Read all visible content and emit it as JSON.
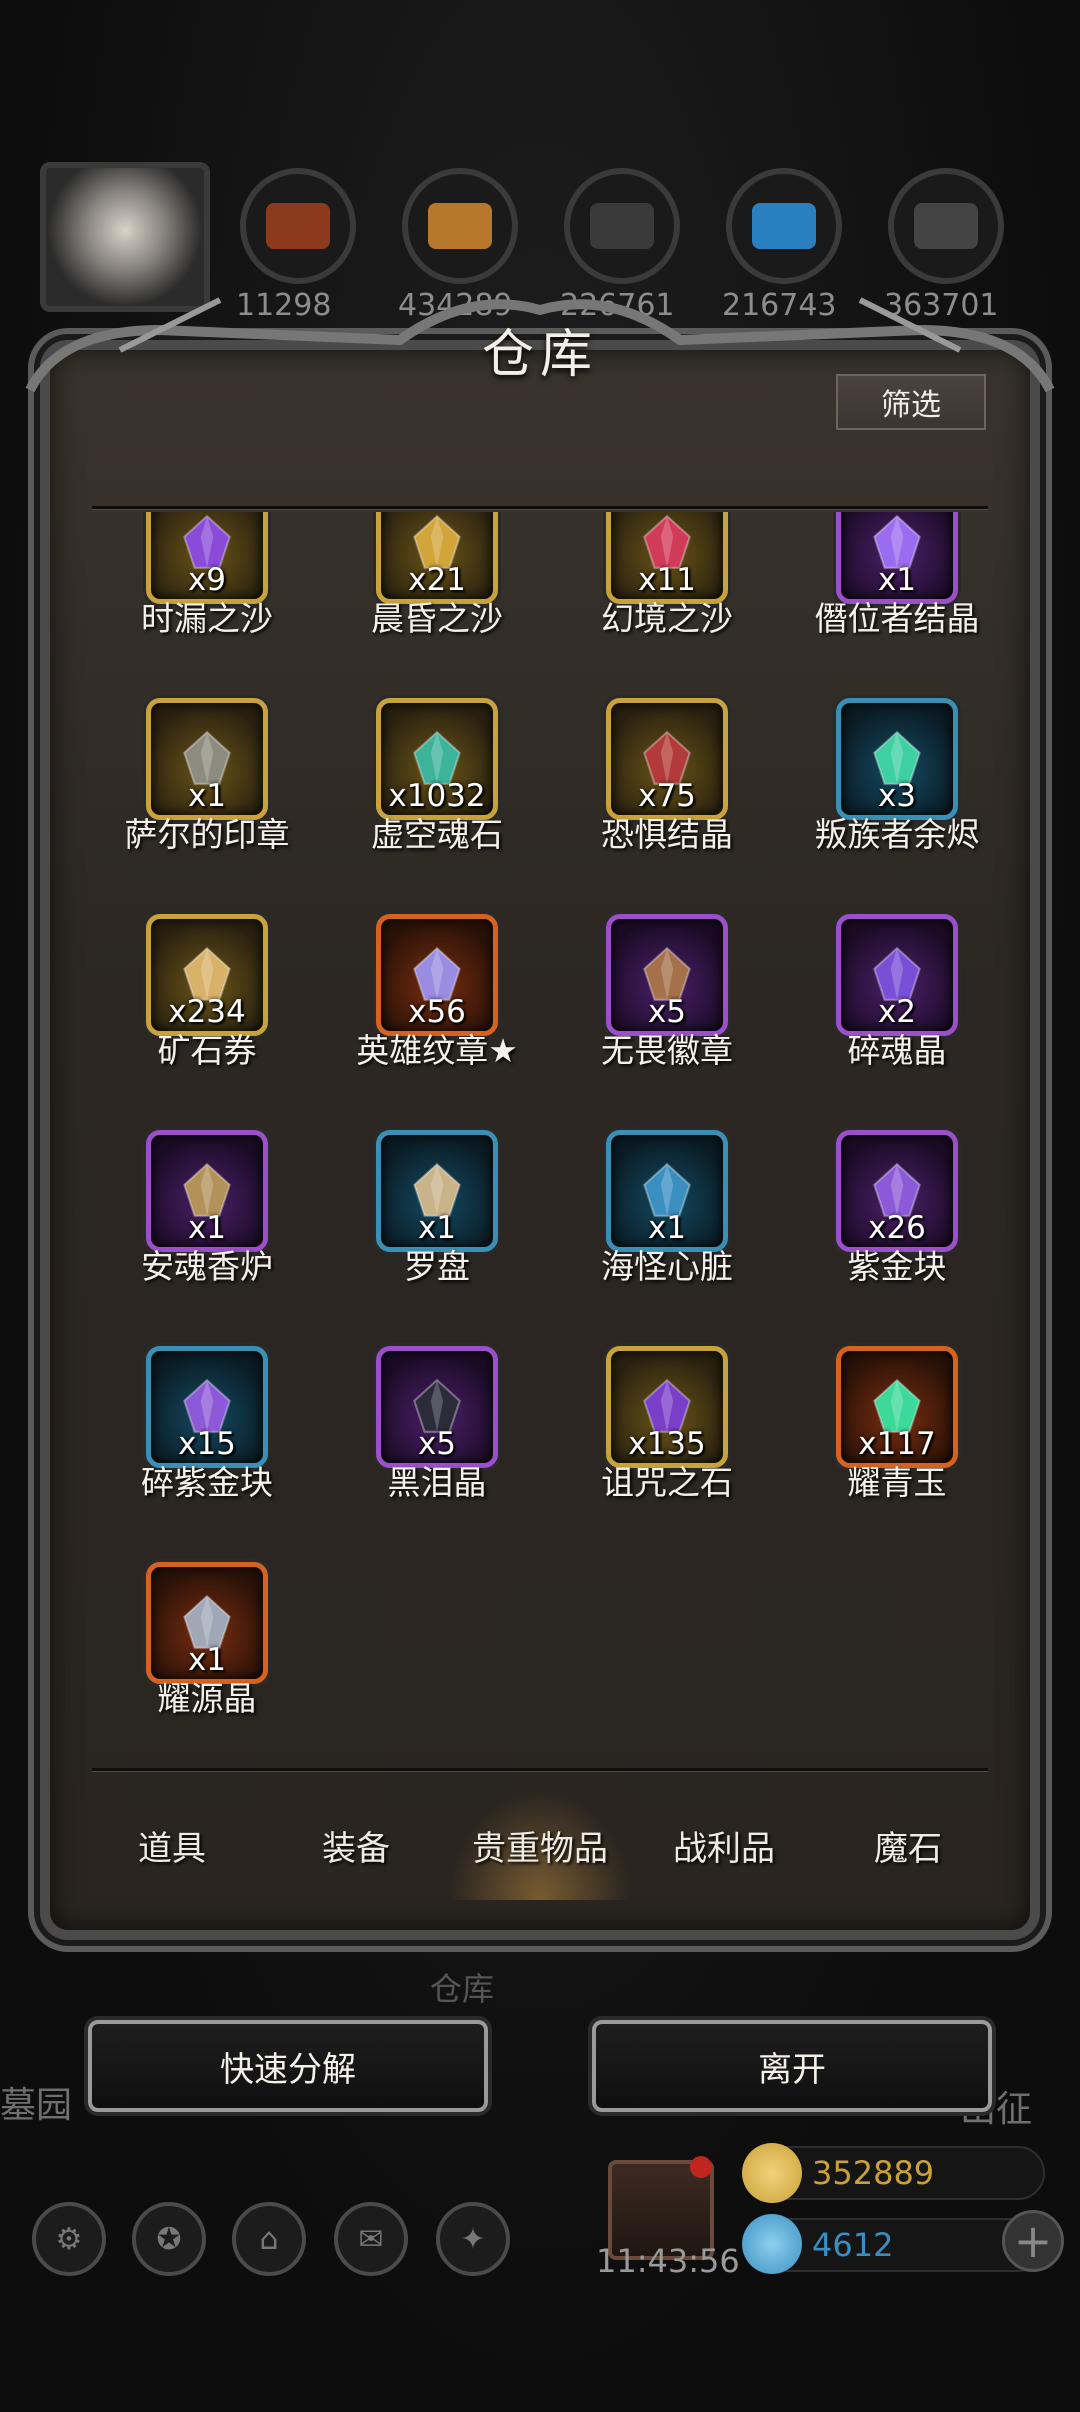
{
  "panel": {
    "title": "仓库",
    "filter_label": "筛选"
  },
  "top_resources": {
    "values": [
      "11298",
      "434289",
      "226761",
      "216743",
      "363701"
    ],
    "colors": [
      "#8b3a1d",
      "#b7772c",
      "#3a3a3a",
      "#2a7fc0",
      "#444444"
    ]
  },
  "items": [
    {
      "name": "时漏之沙",
      "count": "x9",
      "rarity": "gold",
      "color": "#8a4bd8"
    },
    {
      "name": "晨昏之沙",
      "count": "x21",
      "rarity": "gold",
      "color": "#d2a53a"
    },
    {
      "name": "幻境之沙",
      "count": "x11",
      "rarity": "gold",
      "color": "#d23a5a"
    },
    {
      "name": "僭位者结晶",
      "count": "x1",
      "rarity": "purple",
      "color": "#9b6cf0"
    },
    {
      "name": "萨尔的印章",
      "count": "x1",
      "rarity": "gold",
      "color": "#8c8c80"
    },
    {
      "name": "虚空魂石",
      "count": "x1032",
      "rarity": "gold",
      "color": "#3db39a"
    },
    {
      "name": "恐惧结晶",
      "count": "x75",
      "rarity": "gold",
      "color": "#b33a3a"
    },
    {
      "name": "叛族者余烬",
      "count": "x3",
      "rarity": "blue",
      "color": "#3ed0a0"
    },
    {
      "name": "矿石券",
      "count": "x234",
      "rarity": "gold",
      "color": "#d9b26a"
    },
    {
      "name": "英雄纹章★",
      "count": "x56",
      "rarity": "orange",
      "color": "#9a8ce0"
    },
    {
      "name": "无畏徽章",
      "count": "x5",
      "rarity": "purple",
      "color": "#a6704a"
    },
    {
      "name": "碎魂晶",
      "count": "x2",
      "rarity": "purple",
      "color": "#7a4fd8"
    },
    {
      "name": "安魂香炉",
      "count": "x1",
      "rarity": "purple",
      "color": "#b3925a"
    },
    {
      "name": "罗盘",
      "count": "x1",
      "rarity": "blue",
      "color": "#c9b48a"
    },
    {
      "name": "海怪心脏",
      "count": "x1",
      "rarity": "blue",
      "color": "#3a8fc0"
    },
    {
      "name": "紫金块",
      "count": "x26",
      "rarity": "purple",
      "color": "#8c5ad8"
    },
    {
      "name": "碎紫金块",
      "count": "x15",
      "rarity": "blue",
      "color": "#8c5ad8"
    },
    {
      "name": "黑泪晶",
      "count": "x5",
      "rarity": "purple",
      "color": "#2b2b3a"
    },
    {
      "name": "诅咒之石",
      "count": "x135",
      "rarity": "gold",
      "color": "#7a3fc8"
    },
    {
      "name": "耀青玉",
      "count": "x117",
      "rarity": "orange",
      "color": "#3dd99a"
    },
    {
      "name": "耀源晶",
      "count": "x1",
      "rarity": "orange",
      "color": "#a0a8b8"
    }
  ],
  "tabs": [
    "道具",
    "装备",
    "贵重物品",
    "战利品",
    "魔石"
  ],
  "active_tab": "贵重物品",
  "buttons": {
    "decompose": "快速分解",
    "leave": "离开"
  },
  "background_labels": {
    "left": "墓园",
    "right": "出征",
    "center": "仓库"
  },
  "hud": {
    "timer": "11:43:56",
    "gold": "352889",
    "gems": "4612",
    "gold_color": "#c9a13a",
    "gems_color": "#3a8fc0",
    "plus": "+"
  }
}
